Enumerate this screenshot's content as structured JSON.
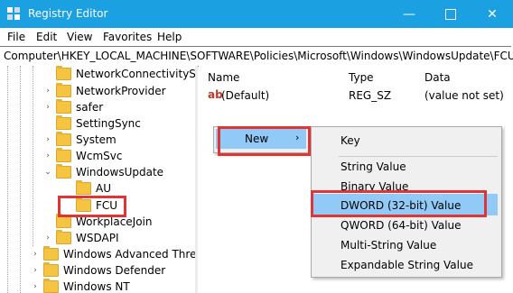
{
  "window": {
    "title": "Registry Editor",
    "icon": "registry-icon"
  },
  "menu": [
    "File",
    "Edit",
    "View",
    "Favorites",
    "Help"
  ],
  "address": "Computer\\HKEY_LOCAL_MACHINE\\SOFTWARE\\Policies\\Microsoft\\Windows\\WindowsUpdate\\FCU",
  "tree": [
    {
      "label": "NetworkConnectivityS"
    },
    {
      "label": "NetworkProvider"
    },
    {
      "label": "safer"
    },
    {
      "label": "SettingSync"
    },
    {
      "label": "System"
    },
    {
      "label": "WcmSvc"
    },
    {
      "label": "WindowsUpdate"
    },
    {
      "label": "AU"
    },
    {
      "label": "FCU"
    },
    {
      "label": "WorkplaceJoin"
    },
    {
      "label": "WSDAPI"
    },
    {
      "label": "Windows Advanced Thre"
    },
    {
      "label": "Windows Defender"
    },
    {
      "label": "Windows NT"
    }
  ],
  "list": {
    "headers": {
      "name": "Name",
      "type": "Type",
      "data": "Data"
    },
    "rows": [
      {
        "name": "(Default)",
        "type": "REG_SZ",
        "data": "(value not set)"
      }
    ]
  },
  "context_menu": {
    "new_label": "New",
    "arrow": "›"
  },
  "submenu": {
    "items": [
      "Key",
      "String Value",
      "Binary Value",
      "DWORD (32-bit) Value",
      "QWORD (64-bit) Value",
      "Multi-String Value",
      "Expandable String Value"
    ]
  },
  "colors": {
    "titlebar": "#1ba1e2",
    "highlight": "#91c9f7",
    "callout": "#e03535",
    "folder": "#f5c542"
  }
}
